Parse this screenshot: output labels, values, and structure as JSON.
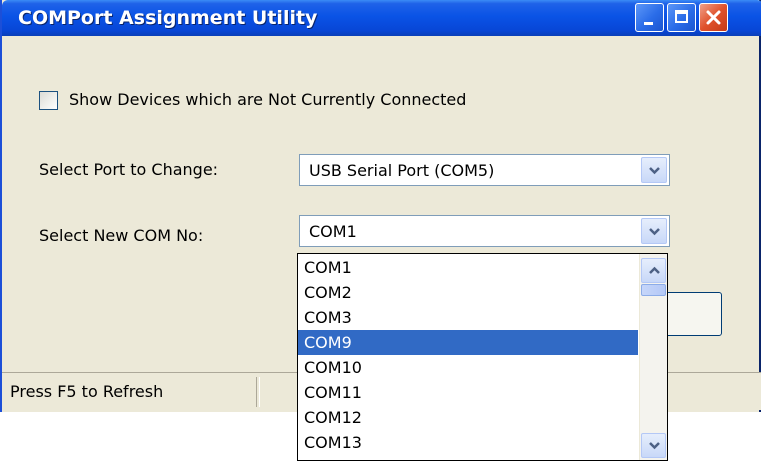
{
  "window": {
    "title": "COMPort Assignment Utility"
  },
  "options": {
    "show_disconnected_label": "Show Devices which are Not Currently Connected",
    "show_disconnected_checked": false
  },
  "port_select": {
    "label": "Select Port to Change:",
    "value": "USB Serial Port (COM5)"
  },
  "com_select": {
    "label": "Select New COM No:",
    "value": "COM1",
    "list_items": [
      "COM1",
      "COM2",
      "COM3",
      "COM9",
      "COM10",
      "COM11",
      "COM12",
      "COM13"
    ],
    "highlighted": "COM9"
  },
  "status": {
    "text": "Press F5 to Refresh"
  },
  "colors": {
    "titlebar": "#0a53e6",
    "selection": "#316ac5",
    "window_bg": "#ece9d8"
  }
}
